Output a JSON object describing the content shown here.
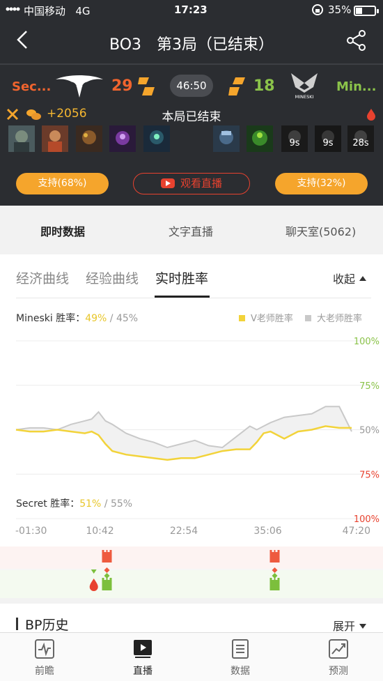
{
  "status_bar": {
    "carrier": "中国移动",
    "network": "4G",
    "time": "17:23",
    "battery": "35%"
  },
  "nav": {
    "title": "BO3　第3局（已结束）"
  },
  "match": {
    "left_team": {
      "name": "Sec...",
      "score": "29",
      "color": "#f0642e",
      "support_label": "支持(68%)"
    },
    "right_team": {
      "name": "Min...",
      "score": "18",
      "color": "#8bc34a",
      "support_label": "支持(32%)",
      "logo_text": "MINESKI"
    },
    "game_time": "46:50",
    "gold_diff": "+2056",
    "status": "本局已结束",
    "live_button": "观看直播",
    "right_hero_timers": [
      "9s",
      "9s",
      "28s"
    ]
  },
  "tabs_main": [
    {
      "label": "即时数据",
      "active": true
    },
    {
      "label": "文字直播",
      "active": false
    },
    {
      "label": "聊天室(5062)",
      "active": false
    }
  ],
  "sub_tabs": [
    {
      "label": "经济曲线",
      "active": false
    },
    {
      "label": "经验曲线",
      "active": false
    },
    {
      "label": "实时胜率",
      "active": true
    }
  ],
  "collapse_label": "收起",
  "winrate": {
    "mineski_label": "Mineski 胜率：",
    "mineski_v": "49%",
    "mineski_sep": " / ",
    "mineski_g": "45%",
    "secret_label": "Secret 胜率：",
    "secret_v": "51%",
    "secret_sep": " / ",
    "secret_g": "55%"
  },
  "legend": {
    "v_label": "V老师胜率",
    "g_label": "大老师胜率",
    "v_color": "#f2d33a",
    "g_color": "#c9c9c9"
  },
  "chart_data": {
    "type": "line",
    "x_ticks": [
      "-01:30",
      "10:42",
      "22:54",
      "35:06",
      "47:20"
    ],
    "y_ticks_right": [
      "100%",
      "75%",
      "50%",
      "75%",
      "100%"
    ],
    "x_minutes": [
      -1.5,
      0.5,
      2.5,
      4.5,
      6.5,
      8.5,
      9.5,
      10.5,
      11.5,
      12.5,
      14.5,
      16.5,
      18.5,
      20.5,
      22.5,
      24.5,
      26.5,
      28.5,
      30.5,
      32.5,
      33.5,
      34.5,
      35.5,
      37.5,
      39.5,
      41.5,
      43.5,
      45.5,
      47.3
    ],
    "series": [
      {
        "name": "V老师胜率",
        "values": [
          50,
          49,
          49,
          50,
          49,
          48,
          49,
          47,
          42,
          38,
          36,
          35,
          34,
          33,
          34,
          34,
          36,
          38,
          39,
          39,
          43,
          48,
          49,
          45,
          49,
          50,
          52,
          51,
          51
        ]
      },
      {
        "name": "大老师胜率",
        "values": [
          50,
          51,
          51,
          50,
          53,
          55,
          56,
          60,
          55,
          53,
          48,
          45,
          43,
          40,
          42,
          44,
          41,
          40,
          46,
          52,
          50,
          52,
          54,
          57,
          58,
          59,
          63,
          63,
          49
        ]
      }
    ],
    "events": [
      {
        "time": "10:42",
        "type": "tower",
        "team": "Secret"
      },
      {
        "time": "10:42",
        "type": "tower",
        "team": "Mineski"
      },
      {
        "time": "35:06",
        "type": "tower",
        "team": "Secret"
      },
      {
        "time": "35:06",
        "type": "tower",
        "team": "Mineski"
      },
      {
        "time": "09:00",
        "type": "first-blood",
        "team": "Mineski"
      }
    ]
  },
  "bp_history": {
    "title": "BP历史",
    "expand_label": "展开"
  },
  "bottom_nav": [
    {
      "label": "前瞻",
      "icon": "preview-icon",
      "active": false
    },
    {
      "label": "直播",
      "icon": "play-icon",
      "active": true
    },
    {
      "label": "数据",
      "icon": "document-icon",
      "active": false
    },
    {
      "label": "预测",
      "icon": "trend-icon",
      "active": false
    }
  ]
}
